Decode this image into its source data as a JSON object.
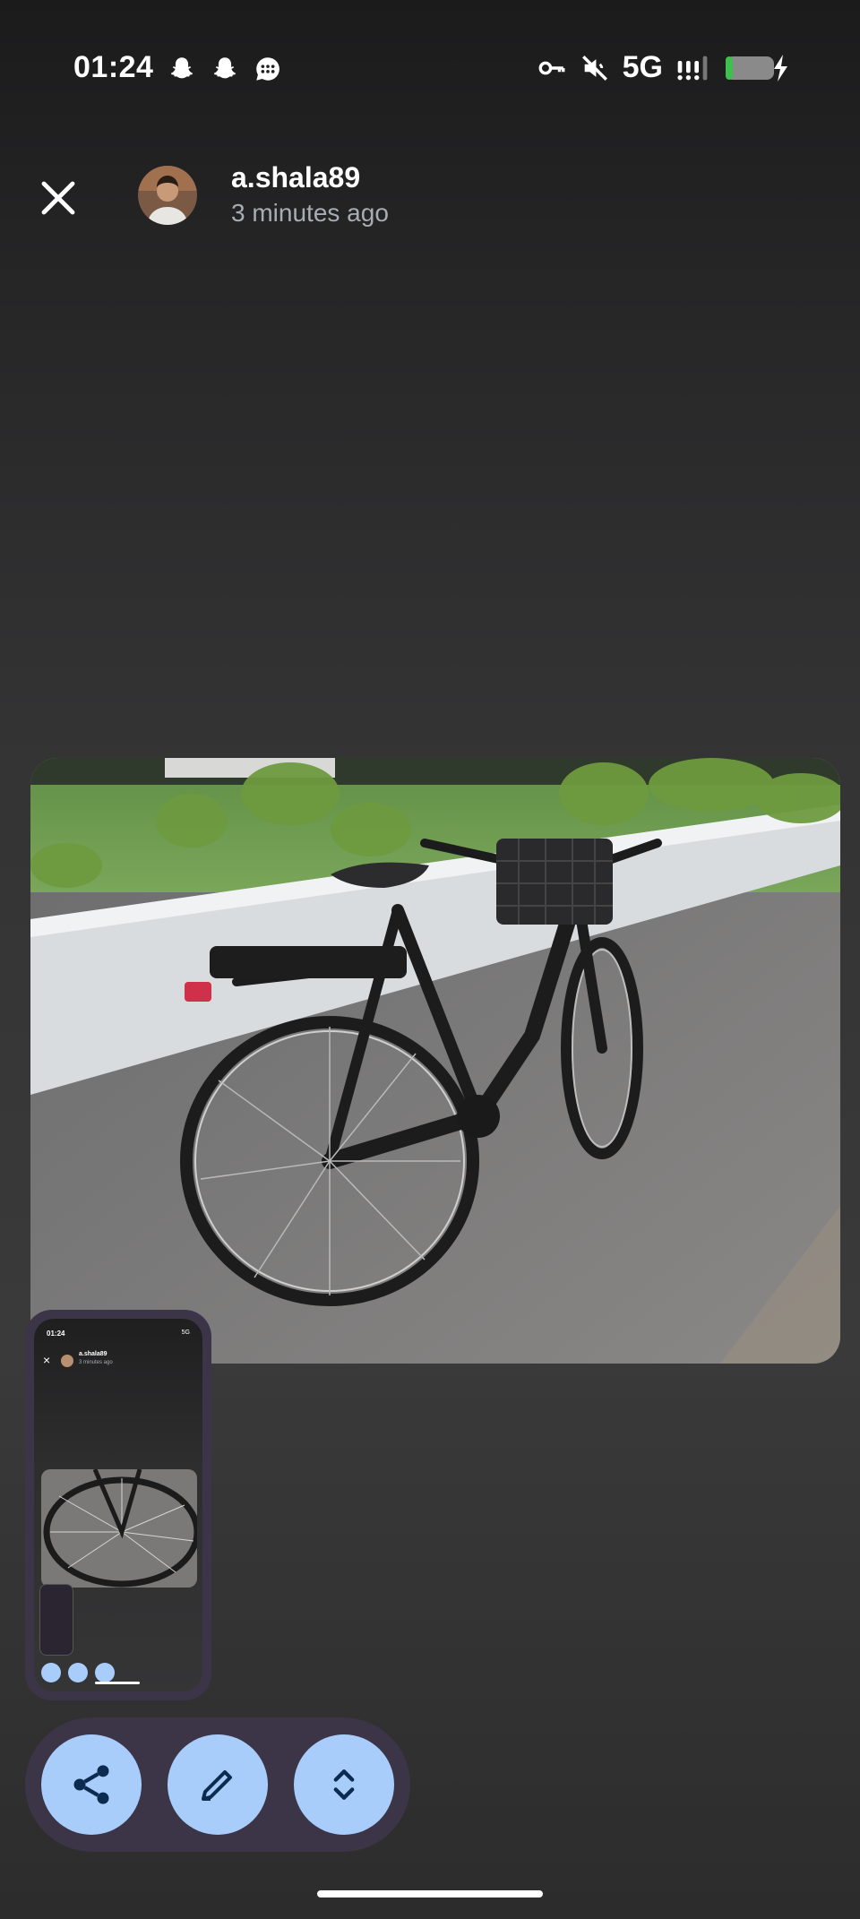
{
  "status_bar": {
    "time": "01:24",
    "left_icons": [
      "snapchat-icon",
      "snapchat-icon",
      "messages-icon"
    ],
    "right_icons": [
      "vpn-key-icon",
      "mute-icon",
      "signal-icon",
      "battery-charging-icon"
    ],
    "network": "5G",
    "battery_color": "#3fbf4f"
  },
  "header": {
    "username": "a.shala89",
    "timestamp": "3 minutes ago"
  },
  "thumbnail": {
    "username": "a.shala89",
    "timestamp": "3 minutes ago",
    "time": "01:24",
    "network": "5G"
  },
  "actions": [
    "share-icon",
    "edit-icon",
    "expand-icon"
  ],
  "colors": {
    "accent_button": "#a9cdfb",
    "pill_background": "#3c3547",
    "icon_dark": "#0b2b4f"
  }
}
